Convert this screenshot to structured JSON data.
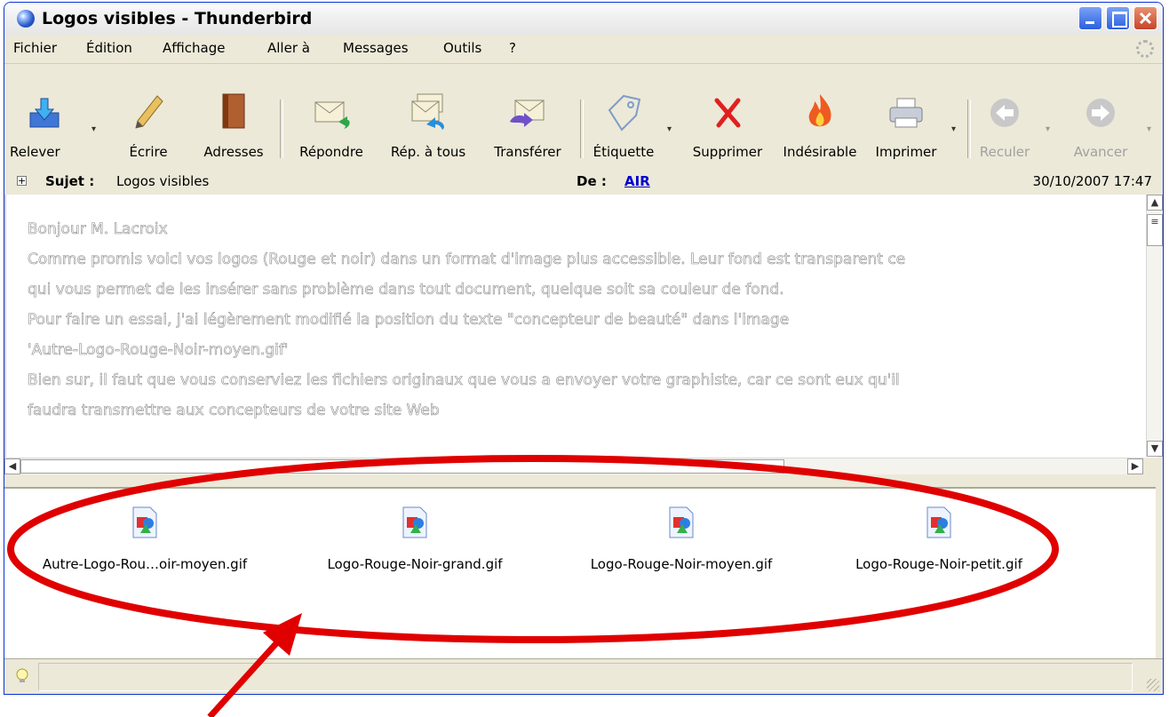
{
  "window": {
    "title": "Logos visibles - Thunderbird"
  },
  "menu": [
    "Fichier",
    "Édition",
    "Affichage",
    "Aller à",
    "Messages",
    "Outils",
    "?"
  ],
  "toolbar": {
    "get": "Relever",
    "write": "Écrire",
    "address": "Adresses",
    "reply": "Répondre",
    "reply_all": "Rép. à tous",
    "forward": "Transférer",
    "tag": "Étiquette",
    "delete": "Supprimer",
    "junk": "Indésirable",
    "print": "Imprimer",
    "back": "Reculer",
    "forward_nav": "Avancer"
  },
  "header": {
    "subject_label": "Sujet :",
    "subject": "Logos visibles",
    "from_label": "De :",
    "from": "AIR",
    "date": "30/10/2007 17:47"
  },
  "body": {
    "lines": [
      "Bonjour M. Lacroix",
      "Comme promis voici vos logos (Rouge et noir) dans un format d'image plus accessible. Leur fond est transparent ce",
      "qui vous permet de les insérer sans problème dans tout document, quelque soit sa couleur de fond.",
      "Pour faire un essai, j'ai légèrement modifié la position du texte \"concepteur de beauté\" dans l'image",
      "'Autre-Logo-Rouge-Noir-moyen.gif'",
      "Bien sur, il faut que vous conserviez les fichiers originaux que vous a envoyer votre graphiste, car ce sont eux qu'il",
      "faudra transmettre aux concepteurs de votre site Web"
    ]
  },
  "attachments": [
    "Autre-Logo-Rou…oir-moyen.gif",
    "Logo-Rouge-Noir-grand.gif",
    "Logo-Rouge-Noir-moyen.gif",
    "Logo-Rouge-Noir-petit.gif"
  ],
  "colors": {
    "annotation": "#e00000",
    "link": "#0000cc"
  }
}
